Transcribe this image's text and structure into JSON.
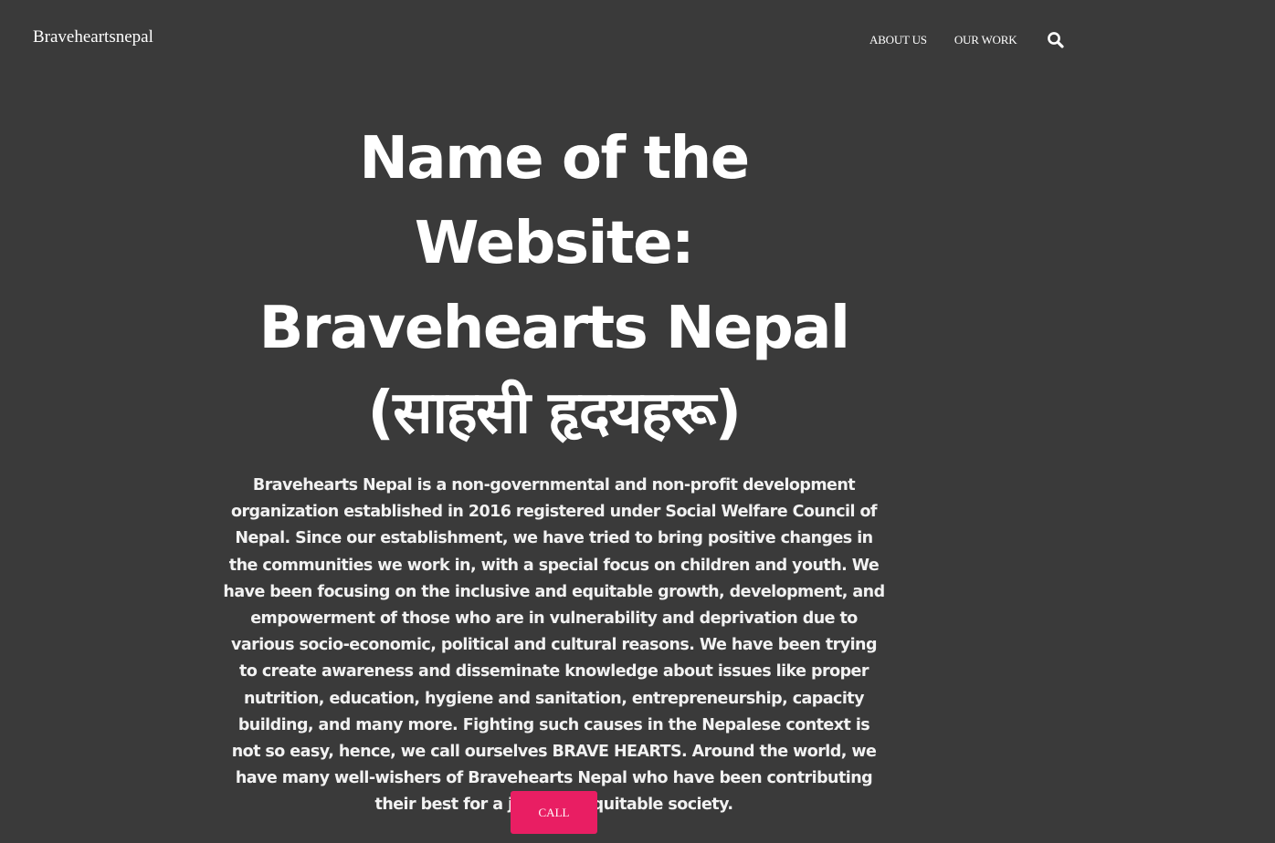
{
  "header": {
    "site_title": "Braveheartsnepal",
    "nav": [
      {
        "label": "ABOUT US"
      },
      {
        "label": "OUR WORK"
      }
    ],
    "search_icon": "search-icon"
  },
  "hero": {
    "title": "Name of the Website: Bravehearts Nepal (साहसी हृदयहरू)",
    "description": "Bravehearts Nepal is a non-governmental and non-profit development organization established in 2016 registered under Social Welfare Council of Nepal. Since our establishment, we have tried to bring positive changes in the communities we work in, with a special focus on children and youth. We have been focusing on the inclusive and equitable growth, development, and empowerment of those who are in vulnerability and deprivation due to various socio-economic, political and cultural reasons. We have been trying to create awareness and disseminate knowledge about issues like proper nutrition, education, hygiene and sanitation, entrepreneurship, capacity building, and many more. Fighting such causes in the Nepalese context is not so easy, hence, we call ourselves BRAVE HEARTS. Around the world, we have many well-wishers of Bravehearts Nepal who have been contributing their best for a just and equitable society.",
    "cta_label": "CALL"
  },
  "colors": {
    "background": "#3a3a3a",
    "accent": "#e91e63",
    "text": "#ffffff"
  }
}
